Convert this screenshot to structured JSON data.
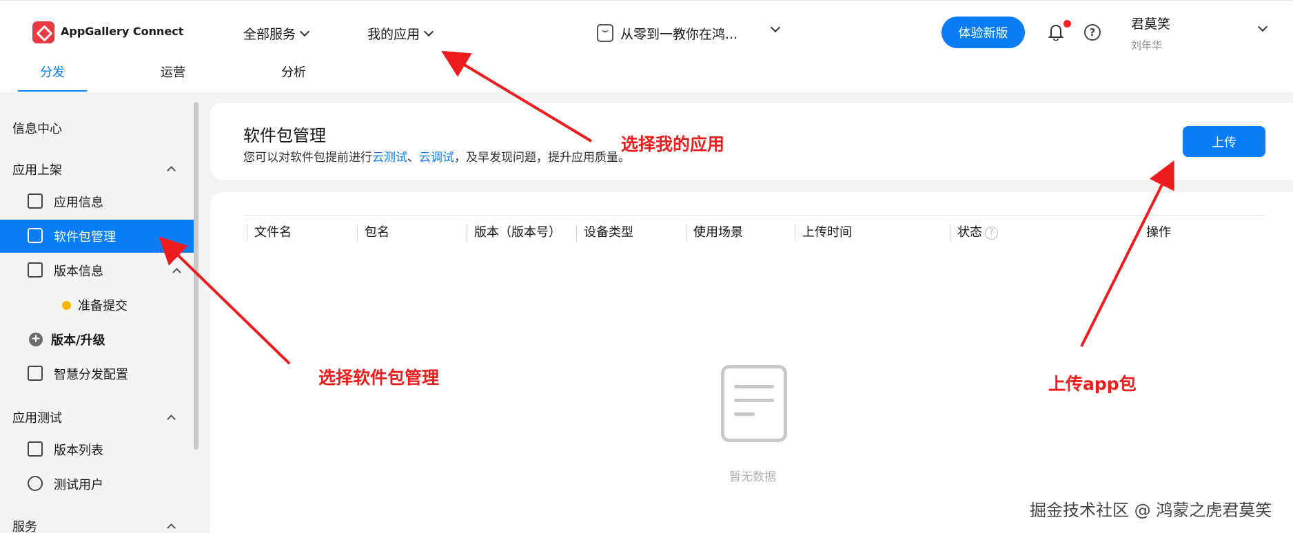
{
  "header": {
    "brand": "AppGallery Connect",
    "menu_all_services": "全部服务",
    "menu_my_apps": "我的应用",
    "app_name": "从零到一教你在鸿...",
    "try_new_version": "体验新版",
    "user_name": "君莫笑",
    "user_sub": "刘年华"
  },
  "tabs": [
    "分发",
    "运营",
    "分析"
  ],
  "sidebar": {
    "info_center": "信息中心",
    "app_listing": "应用上架",
    "app_info": "应用信息",
    "package_mgmt": "软件包管理",
    "version_info": "版本信息",
    "ready_submit": "准备提交",
    "version_upgrade": "版本/升级",
    "smart_distribution": "智慧分发配置",
    "app_testing": "应用测试",
    "version_list": "版本列表",
    "test_users": "测试用户",
    "services": "服务"
  },
  "main": {
    "title": "软件包管理",
    "desc_prefix": "您可以对软件包提前进行",
    "desc_link1": "云测试",
    "desc_sep": "、",
    "desc_link2": "云调试",
    "desc_suffix": "，及早发现问题，提升应用质量。",
    "upload_button": "上传",
    "columns": [
      "文件名",
      "包名",
      "版本（版本号）",
      "设备类型",
      "使用场景",
      "上传时间",
      "状态",
      "操作"
    ],
    "empty_text": "暂无数据"
  },
  "annotations": {
    "select_my_app": "选择我的应用",
    "select_package_mgmt": "选择软件包管理",
    "upload_app_package": "上传app包"
  },
  "watermark": "掘金技术社区 @ 鸿蒙之虎君莫笑",
  "colors": {
    "accent": "#0a7df8",
    "annotation": "#ee1c1c",
    "brand_logo": "#e83a3f"
  }
}
